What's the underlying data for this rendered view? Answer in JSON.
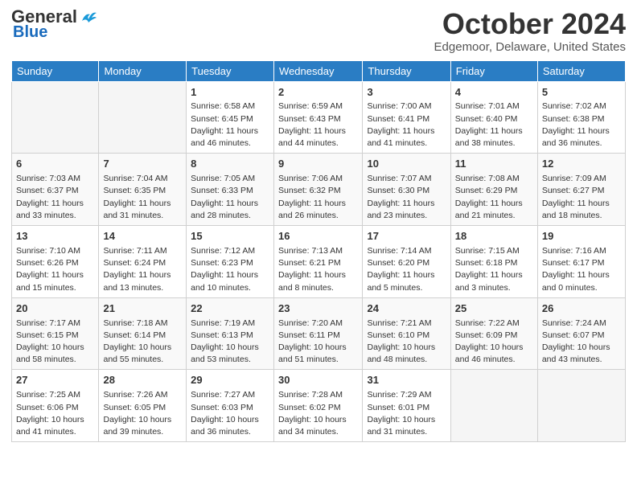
{
  "logo": {
    "line1": "General",
    "line2": "Blue",
    "bird_color": "#1a9ad9"
  },
  "title": "October 2024",
  "subtitle": "Edgemoor, Delaware, United States",
  "weekdays": [
    "Sunday",
    "Monday",
    "Tuesday",
    "Wednesday",
    "Thursday",
    "Friday",
    "Saturday"
  ],
  "weeks": [
    [
      {
        "day": null
      },
      {
        "day": null
      },
      {
        "day": 1,
        "sunrise": "6:58 AM",
        "sunset": "6:45 PM",
        "daylight": "11 hours and 46 minutes."
      },
      {
        "day": 2,
        "sunrise": "6:59 AM",
        "sunset": "6:43 PM",
        "daylight": "11 hours and 44 minutes."
      },
      {
        "day": 3,
        "sunrise": "7:00 AM",
        "sunset": "6:41 PM",
        "daylight": "11 hours and 41 minutes."
      },
      {
        "day": 4,
        "sunrise": "7:01 AM",
        "sunset": "6:40 PM",
        "daylight": "11 hours and 38 minutes."
      },
      {
        "day": 5,
        "sunrise": "7:02 AM",
        "sunset": "6:38 PM",
        "daylight": "11 hours and 36 minutes."
      }
    ],
    [
      {
        "day": 6,
        "sunrise": "7:03 AM",
        "sunset": "6:37 PM",
        "daylight": "11 hours and 33 minutes."
      },
      {
        "day": 7,
        "sunrise": "7:04 AM",
        "sunset": "6:35 PM",
        "daylight": "11 hours and 31 minutes."
      },
      {
        "day": 8,
        "sunrise": "7:05 AM",
        "sunset": "6:33 PM",
        "daylight": "11 hours and 28 minutes."
      },
      {
        "day": 9,
        "sunrise": "7:06 AM",
        "sunset": "6:32 PM",
        "daylight": "11 hours and 26 minutes."
      },
      {
        "day": 10,
        "sunrise": "7:07 AM",
        "sunset": "6:30 PM",
        "daylight": "11 hours and 23 minutes."
      },
      {
        "day": 11,
        "sunrise": "7:08 AM",
        "sunset": "6:29 PM",
        "daylight": "11 hours and 21 minutes."
      },
      {
        "day": 12,
        "sunrise": "7:09 AM",
        "sunset": "6:27 PM",
        "daylight": "11 hours and 18 minutes."
      }
    ],
    [
      {
        "day": 13,
        "sunrise": "7:10 AM",
        "sunset": "6:26 PM",
        "daylight": "11 hours and 15 minutes."
      },
      {
        "day": 14,
        "sunrise": "7:11 AM",
        "sunset": "6:24 PM",
        "daylight": "11 hours and 13 minutes."
      },
      {
        "day": 15,
        "sunrise": "7:12 AM",
        "sunset": "6:23 PM",
        "daylight": "11 hours and 10 minutes."
      },
      {
        "day": 16,
        "sunrise": "7:13 AM",
        "sunset": "6:21 PM",
        "daylight": "11 hours and 8 minutes."
      },
      {
        "day": 17,
        "sunrise": "7:14 AM",
        "sunset": "6:20 PM",
        "daylight": "11 hours and 5 minutes."
      },
      {
        "day": 18,
        "sunrise": "7:15 AM",
        "sunset": "6:18 PM",
        "daylight": "11 hours and 3 minutes."
      },
      {
        "day": 19,
        "sunrise": "7:16 AM",
        "sunset": "6:17 PM",
        "daylight": "11 hours and 0 minutes."
      }
    ],
    [
      {
        "day": 20,
        "sunrise": "7:17 AM",
        "sunset": "6:15 PM",
        "daylight": "10 hours and 58 minutes."
      },
      {
        "day": 21,
        "sunrise": "7:18 AM",
        "sunset": "6:14 PM",
        "daylight": "10 hours and 55 minutes."
      },
      {
        "day": 22,
        "sunrise": "7:19 AM",
        "sunset": "6:13 PM",
        "daylight": "10 hours and 53 minutes."
      },
      {
        "day": 23,
        "sunrise": "7:20 AM",
        "sunset": "6:11 PM",
        "daylight": "10 hours and 51 minutes."
      },
      {
        "day": 24,
        "sunrise": "7:21 AM",
        "sunset": "6:10 PM",
        "daylight": "10 hours and 48 minutes."
      },
      {
        "day": 25,
        "sunrise": "7:22 AM",
        "sunset": "6:09 PM",
        "daylight": "10 hours and 46 minutes."
      },
      {
        "day": 26,
        "sunrise": "7:24 AM",
        "sunset": "6:07 PM",
        "daylight": "10 hours and 43 minutes."
      }
    ],
    [
      {
        "day": 27,
        "sunrise": "7:25 AM",
        "sunset": "6:06 PM",
        "daylight": "10 hours and 41 minutes."
      },
      {
        "day": 28,
        "sunrise": "7:26 AM",
        "sunset": "6:05 PM",
        "daylight": "10 hours and 39 minutes."
      },
      {
        "day": 29,
        "sunrise": "7:27 AM",
        "sunset": "6:03 PM",
        "daylight": "10 hours and 36 minutes."
      },
      {
        "day": 30,
        "sunrise": "7:28 AM",
        "sunset": "6:02 PM",
        "daylight": "10 hours and 34 minutes."
      },
      {
        "day": 31,
        "sunrise": "7:29 AM",
        "sunset": "6:01 PM",
        "daylight": "10 hours and 31 minutes."
      },
      {
        "day": null
      },
      {
        "day": null
      }
    ]
  ]
}
